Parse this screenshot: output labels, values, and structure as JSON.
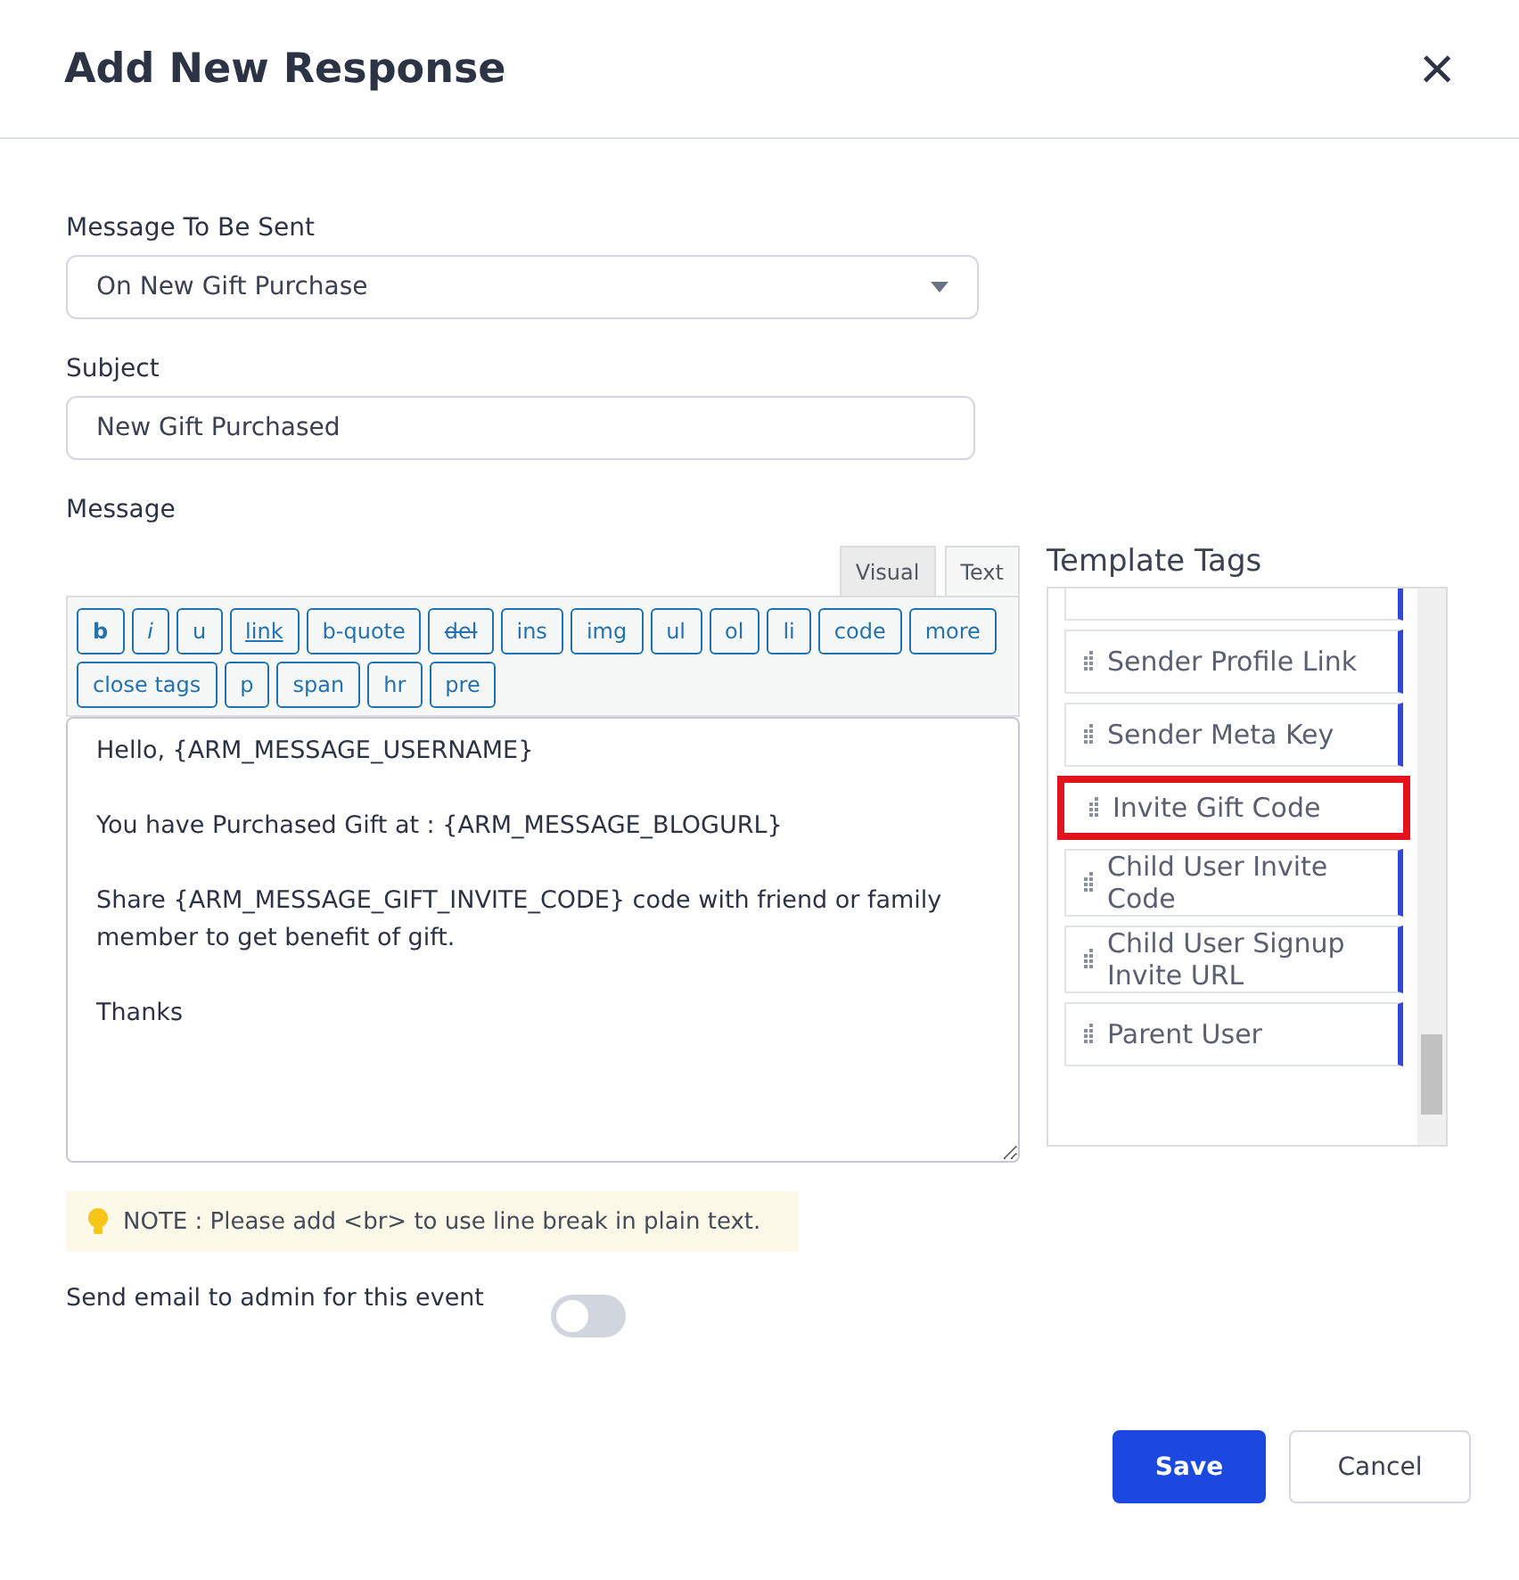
{
  "dialog": {
    "title": "Add New Response",
    "close": "×"
  },
  "message_type": {
    "label": "Message To Be Sent",
    "value": "On New Gift Purchase"
  },
  "subject": {
    "label": "Subject",
    "value": "New Gift Purchased"
  },
  "message": {
    "label": "Message",
    "modes": [
      {
        "label": "Visual",
        "selected": false
      },
      {
        "label": "Text",
        "selected": true
      }
    ],
    "buttons": [
      {
        "label": "b",
        "kind": "bold"
      },
      {
        "label": "i",
        "kind": "italic"
      },
      {
        "label": "u",
        "kind": "plain"
      },
      {
        "label": "link",
        "kind": "underline"
      },
      {
        "label": "b-quote",
        "kind": "plain"
      },
      {
        "label": "del",
        "kind": "strike"
      },
      {
        "label": "ins",
        "kind": "plain"
      },
      {
        "label": "img",
        "kind": "plain"
      },
      {
        "label": "ul",
        "kind": "plain"
      },
      {
        "label": "ol",
        "kind": "plain"
      },
      {
        "label": "li",
        "kind": "plain"
      },
      {
        "label": "code",
        "kind": "plain"
      },
      {
        "label": "more",
        "kind": "plain"
      },
      {
        "label": "close tags",
        "kind": "plain"
      },
      {
        "label": "p",
        "kind": "plain"
      },
      {
        "label": "span",
        "kind": "plain"
      },
      {
        "label": "hr",
        "kind": "plain"
      },
      {
        "label": "pre",
        "kind": "plain"
      }
    ],
    "value": "Hello, {ARM_MESSAGE_USERNAME}\n\nYou have Purchased Gift at : {ARM_MESSAGE_BLOGURL}\n\nShare {ARM_MESSAGE_GIFT_INVITE_CODE} code with friend or family member to get benefit of gift.\n\nThanks"
  },
  "template_tags": {
    "title": "Template Tags",
    "items": [
      {
        "label": "Sender Profile Link",
        "highlighted": false
      },
      {
        "label": "Sender Meta Key",
        "highlighted": false
      },
      {
        "label": "Invite Gift Code",
        "highlighted": true
      },
      {
        "label": "Child User Invite Code",
        "highlighted": false
      },
      {
        "label": "Child User Signup Invite URL",
        "highlighted": false
      },
      {
        "label": "Parent User",
        "highlighted": false
      }
    ]
  },
  "note": "NOTE : Please add <br> to use line break in plain text.",
  "admin_email": {
    "label": "Send email to admin for this event",
    "on": false
  },
  "buttons": [
    {
      "label": "Save",
      "kind": "primary"
    },
    {
      "label": "Cancel",
      "kind": "secondary"
    }
  ]
}
